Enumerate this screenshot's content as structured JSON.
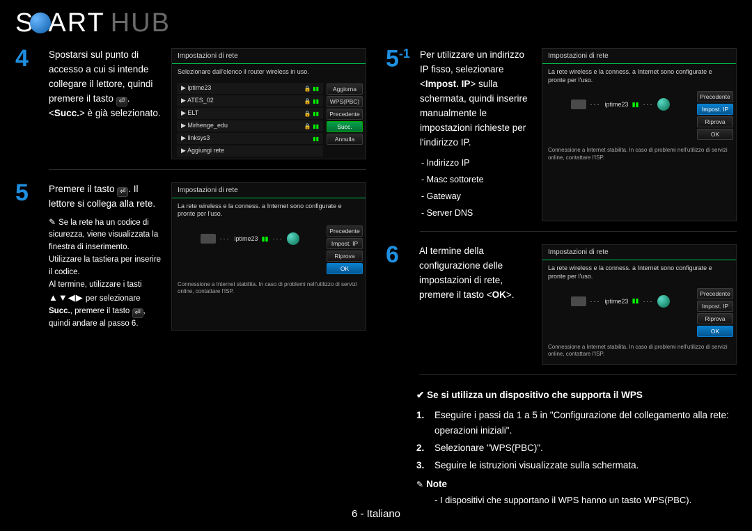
{
  "logo": {
    "s": "S",
    "art": "ART",
    "hub": "HUB"
  },
  "step4": {
    "num": "4",
    "text_a": "Spostarsi sul punto di accesso a cui si intende collegare il lettore, quindi premere il tasto ",
    "text_b": ". <",
    "succ": "Succ.",
    "text_c": "> è già selezionato."
  },
  "step5": {
    "num": "5",
    "text_a": "Premere il tasto ",
    "text_b": ". Il lettore si collega alla rete.",
    "note_a": "Se la rete ha un codice di sicurezza, viene visualizzata la finestra di inserimento. Utilizzare la tastiera per inserire il codice.",
    "note_b": "Al termine, utilizzare i tasti ",
    "note_c": " per selezionare ",
    "note_succ": "Succ.",
    "note_d": ", premere il tasto ",
    "note_e": ", quindi andare al passo 6."
  },
  "step51": {
    "num": "5",
    "sup": "-1",
    "text_a": "Per utilizzare un indirizzo IP fisso, selezionare <",
    "bold": "Impost. IP",
    "text_b": "> sulla schermata, quindi inserire manualmente le impostazioni richieste per l'indirizzo IP.",
    "ip1": "Indirizzo IP",
    "ip2": "Masc sottorete",
    "ip3": "Gateway",
    "ip4": "Server DNS"
  },
  "step6": {
    "num": "6",
    "text_a": "Al termine della configurazione delle impostazioni di rete, premere il tasto <",
    "ok": "OK",
    "text_b": ">."
  },
  "wps": {
    "head": "Se si utilizza un dispositivo che supporta il WPS",
    "li1": "Eseguire i passi da 1 a 5 in \"Configurazione del collegamento alla rete: operazioni iniziali\".",
    "li2": "Selezionare \"WPS(PBC)\".",
    "li3": "Seguire le istruzioni visualizzate sulla schermata.",
    "note_label": "Note",
    "note_text": "I dispositivi che supportano il WPS hanno un tasto WPS(PBC)."
  },
  "mock": {
    "title": "Impostazioni di rete",
    "list_sub": "Selezionare dall'elenco il router wireless in uso.",
    "items": {
      "a": "iptime23",
      "b": "ATES_02",
      "c": "ELT",
      "d": "Mirhenge_edu",
      "e": "linksys3",
      "f": "Aggiungi rete"
    },
    "btn_aggiorna": "Aggiorna",
    "btn_wps": "WPS(PBC)",
    "btn_prec": "Precedente",
    "btn_succ": "Succ.",
    "btn_annulla": "Annulla",
    "btn_impost": "Impost. IP",
    "btn_riprova": "Riprova",
    "btn_ok": "OK",
    "conn_sub": "La rete wireless e la conness. a Internet sono configurate e pronte per l'uso.",
    "conn_host": "iptime23",
    "conn_footer": "Connessione a Internet stabilita. In caso di problemi nell'utilizzo di servizi online, contattare l'ISP."
  },
  "footer": "6 - Italiano"
}
